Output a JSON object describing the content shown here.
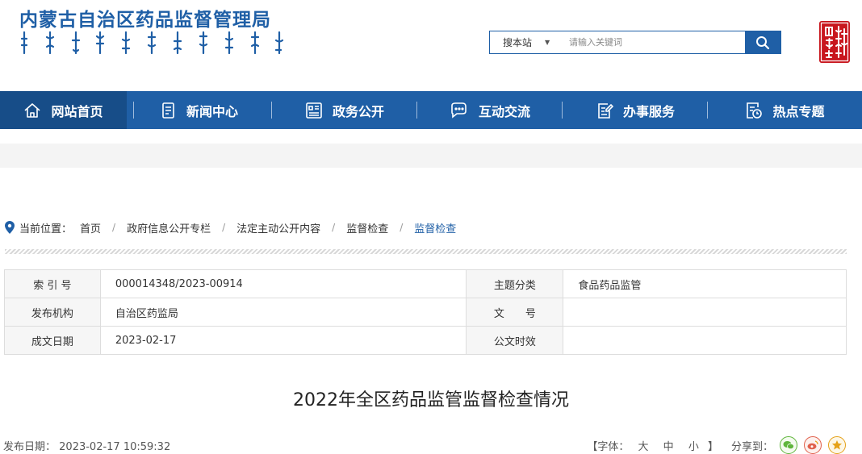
{
  "header": {
    "site_title": "内蒙古自治区药品监督管理局",
    "search": {
      "scope_label": "搜本站",
      "placeholder": "请输入关键词"
    }
  },
  "nav": {
    "items": [
      {
        "label": "网站首页",
        "icon": "home-icon",
        "active": true
      },
      {
        "label": "新闻中心",
        "icon": "document-icon"
      },
      {
        "label": "政务公开",
        "icon": "grid-doc-icon"
      },
      {
        "label": "互动交流",
        "icon": "chat-icon"
      },
      {
        "label": "办事服务",
        "icon": "edit-doc-icon"
      },
      {
        "label": "热点专题",
        "icon": "clock-doc-icon"
      }
    ]
  },
  "breadcrumb": {
    "label": "当前位置：",
    "items": [
      "首页",
      "政府信息公开专栏",
      "法定主动公开内容",
      "监督检查",
      "监督检查"
    ]
  },
  "meta": {
    "rows": [
      {
        "k1": "索 引 号",
        "v1": "000014348/2023-00914",
        "k2": "主题分类",
        "v2": "食品药品监管"
      },
      {
        "k1": "发布机构",
        "v1": "自治区药监局",
        "k2": "文　　号",
        "v2": ""
      },
      {
        "k1": "成文日期",
        "v1": "2023-02-17",
        "k2": "公文时效",
        "v2": ""
      }
    ]
  },
  "article": {
    "title": "2022年全区药品监管监督检查情况",
    "publish_label": "发布日期：",
    "publish_date": "2023-02-17 10:59:32",
    "font_label": "【字体：",
    "font_large": "大",
    "font_medium": "中",
    "font_small": "小",
    "font_close": "】",
    "share_label": "分享到："
  }
}
